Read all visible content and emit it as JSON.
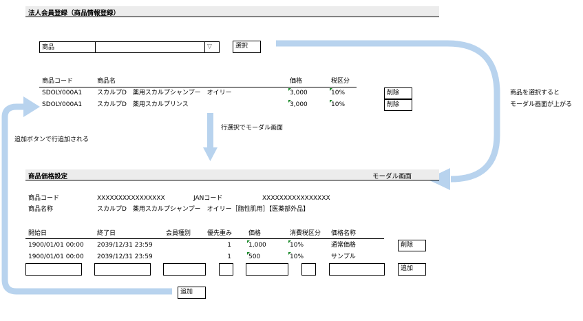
{
  "page_title": "法人会員登録（商品情報登録）",
  "product_filter": {
    "label": "商品",
    "value": "",
    "dropdown_glyph": "▽",
    "select_button": "選択"
  },
  "product_table": {
    "headers": [
      "商品コード",
      "商品名",
      "価格",
      "税区分"
    ],
    "rows": [
      {
        "code": "SDOLY000A1",
        "name": "スカルプD　薬用スカルプシャンプー　オイリー",
        "price": "3,000",
        "tax": "10%",
        "delete": "削除"
      },
      {
        "code": "SDOLY000A1",
        "name": "スカルプD　薬用スカルプリンス",
        "price": "3,000",
        "tax": "10%",
        "delete": "削除"
      }
    ]
  },
  "annotations": {
    "select_note": [
      "商品を選択すると",
      "モーダル画面が上がる"
    ],
    "row_select_note": "行選択でモーダル画面",
    "add_note": "追加ボタンで行追加される"
  },
  "modal": {
    "title": "商品価格設定",
    "modal_label": "モーダル画面",
    "code_label": "商品コード",
    "code_value": "XXXXXXXXXXXXXXXX",
    "jan_label": "JANコード",
    "jan_value": "XXXXXXXXXXXXXXXX",
    "name_label": "商品名称",
    "name_value": "スカルプD　薬用スカルプシャンプー　オイリー［脂性肌用］【医薬部外品】",
    "headers": [
      "開始日",
      "終了日",
      "会員種別",
      "優先重み",
      "価格",
      "消費税区分",
      "価格名称"
    ],
    "rows": [
      {
        "start": "1900/01/01 00:00",
        "end": "2039/12/31 23:59",
        "member": "",
        "priority": "1",
        "price": "1,000",
        "tax": "10%",
        "price_name": "通常価格",
        "delete": "削除"
      },
      {
        "start": "1900/01/01 00:00",
        "end": "2039/12/31 23:59",
        "member": "",
        "priority": "1",
        "price": "500",
        "tax": "10%",
        "price_name": "サンプル",
        "delete": ""
      }
    ],
    "new_row": {
      "start": "",
      "end": "",
      "member": "",
      "priority": "",
      "price": "",
      "tax": "",
      "price_name": "",
      "add_button": "追加"
    },
    "bottom_add_button": "追加"
  },
  "colors": {
    "header_bg": "#ececec",
    "arrow": "#b8d3ee",
    "flag": "#1a8a2a"
  }
}
